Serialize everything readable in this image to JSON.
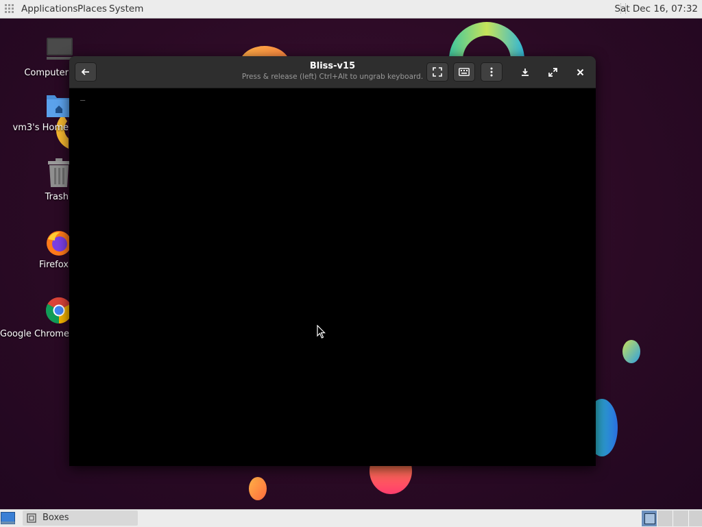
{
  "top_panel": {
    "menus": [
      "Applications",
      "Places",
      "System"
    ],
    "clock": "Sat Dec 16, 07:32"
  },
  "desktop_icons": [
    {
      "label": "Computer",
      "icon": "computer-icon"
    },
    {
      "label": "vm3's Home",
      "icon": "home-folder-icon"
    },
    {
      "label": "Trash",
      "icon": "trash-icon"
    },
    {
      "label": "Firefox",
      "icon": "firefox-icon"
    },
    {
      "label": "Google Chrome",
      "icon": "chrome-icon"
    }
  ],
  "vm_window": {
    "title": "Bliss-v15",
    "subtitle": "Press & release (left) Ctrl+Alt to ungrab keyboard.",
    "buttons": [
      "back-icon",
      "fullscreen-icon",
      "keyboard-icon",
      "menu-dots-icon",
      "download-icon",
      "expand-icon",
      "close-icon"
    ],
    "screen_text": "_"
  },
  "bottom_panel": {
    "task_label": "Boxes",
    "workspaces": 4,
    "active_workspace": 1
  },
  "colors": {
    "desktop_bg": "#2c0b24",
    "headerbar": "#2e2e2e",
    "panel": "#ececec"
  }
}
